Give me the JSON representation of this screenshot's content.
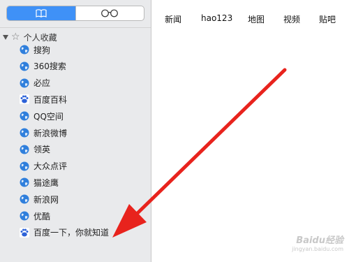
{
  "sidebar": {
    "tabs": [
      {
        "name": "bookmarks",
        "icon": "book-icon",
        "active": true
      },
      {
        "name": "reading-list",
        "icon": "glasses-icon",
        "active": false
      }
    ],
    "section_title": "个人收藏",
    "items": [
      {
        "label": "搜狗",
        "icon": "globe-icon"
      },
      {
        "label": "360搜索",
        "icon": "globe-icon"
      },
      {
        "label": "必应",
        "icon": "globe-icon"
      },
      {
        "label": "百度百科",
        "icon": "baidu-paw-icon"
      },
      {
        "label": "QQ空间",
        "icon": "globe-icon"
      },
      {
        "label": "新浪微博",
        "icon": "globe-icon"
      },
      {
        "label": "领英",
        "icon": "globe-icon"
      },
      {
        "label": "大众点评",
        "icon": "globe-icon"
      },
      {
        "label": "猫途鹰",
        "icon": "globe-icon"
      },
      {
        "label": "新浪网",
        "icon": "globe-icon"
      },
      {
        "label": "优酷",
        "icon": "globe-icon"
      },
      {
        "label": "百度一下，你就知道",
        "icon": "baidu-paw-icon"
      }
    ]
  },
  "topnav": {
    "links": [
      "新闻",
      "hao123",
      "地图",
      "视频",
      "贴吧"
    ]
  },
  "watermark": {
    "logo": "Baidu经验",
    "sub": "jingyan.baidu.com"
  },
  "colors": {
    "accent": "#3f91f7",
    "arrow": "#e8231d",
    "sidebar_bg": "#e9eaec"
  }
}
